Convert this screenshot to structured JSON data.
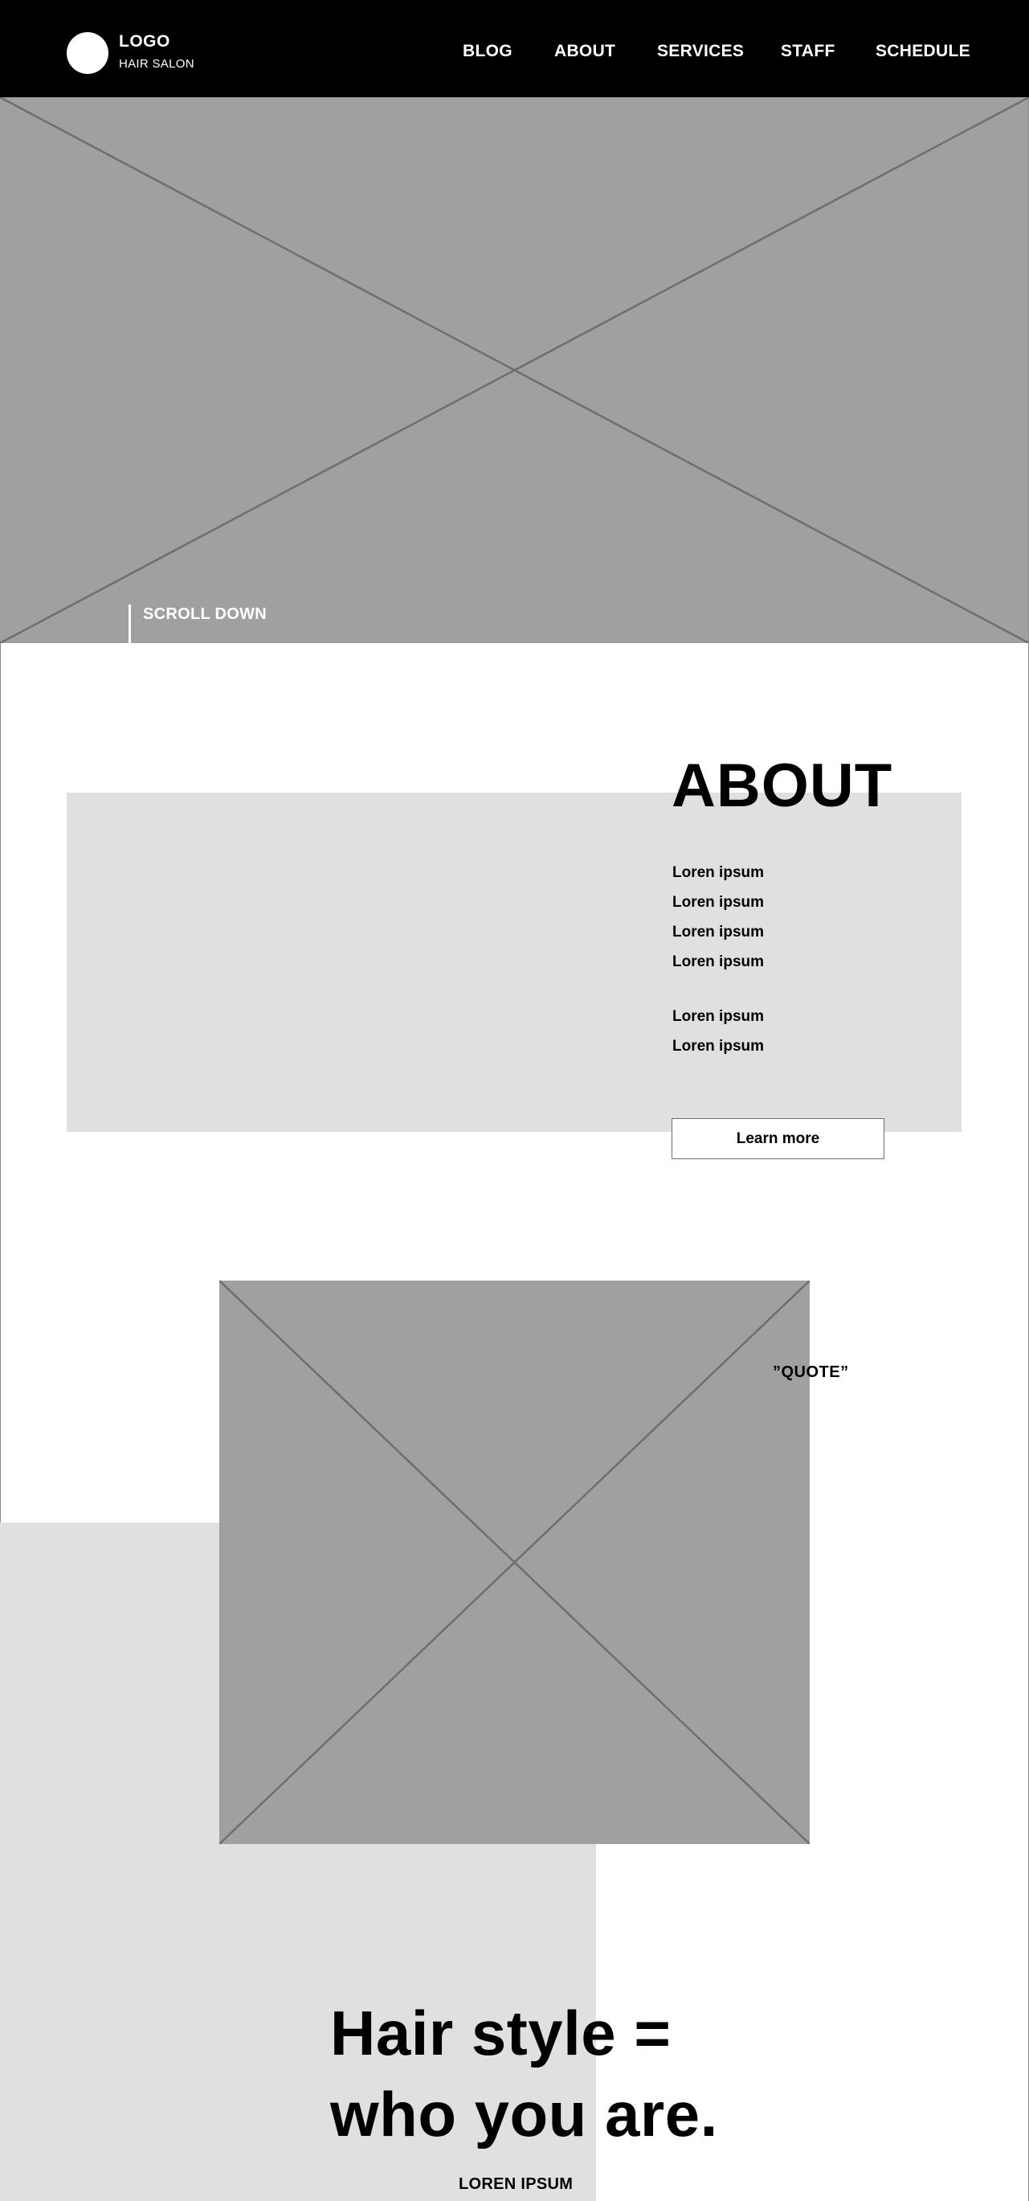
{
  "header": {
    "logo_title": "LOGO",
    "logo_subtitle": "HAIR SALON",
    "nav": [
      "BLOG",
      "ABOUT",
      "SERVICES",
      "STAFF",
      "SCHEDULE"
    ]
  },
  "hero": {
    "image": "placeholder-image",
    "scroll_label": "SCROLL DOWN"
  },
  "about": {
    "heading": "ABOUT",
    "lines": [
      "Loren ipsum",
      "Loren ipsum",
      "Loren ipsum",
      "Loren ipsum",
      "Loren ipsum",
      "Loren ipsum"
    ],
    "button_label": "Learn more"
  },
  "feature": {
    "image": "placeholder-image",
    "quote": "”QUOTE”",
    "headline_line1": "Hair style =",
    "headline_line2": "who you are.",
    "caption": "LOREN IPSUM"
  },
  "colors": {
    "header_bg": "#000000",
    "placeholder_gray": "#a0a0a0",
    "panel_beige": "#e2e0df",
    "text": "#000000"
  }
}
